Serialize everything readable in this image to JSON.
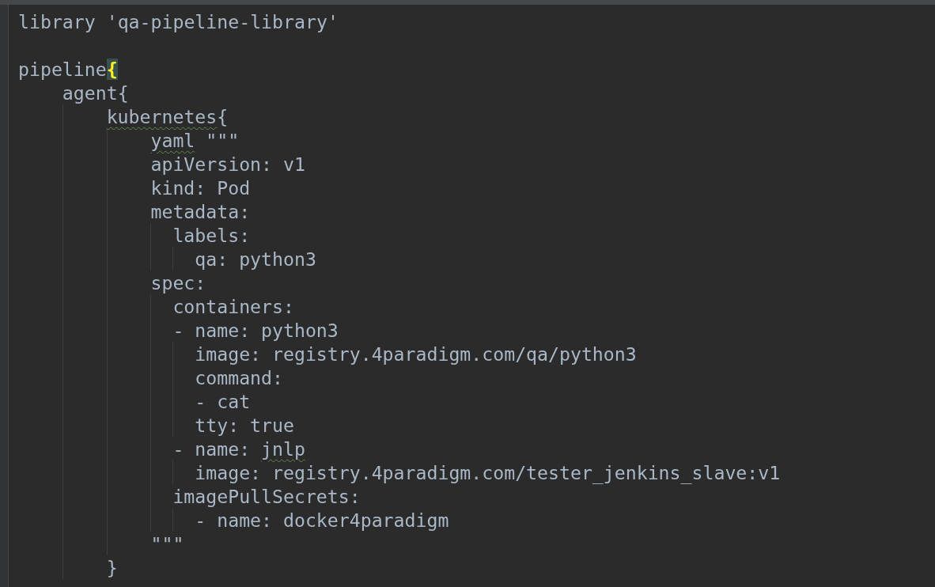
{
  "editor": {
    "lines": [
      {
        "kind": "code",
        "parts": [
          {
            "kind": "plain",
            "text": "library 'qa-pipeline-library'"
          }
        ]
      },
      {
        "kind": "blank"
      },
      {
        "kind": "code",
        "parts": [
          {
            "kind": "plain",
            "text": "pipeline"
          },
          {
            "kind": "brace-match",
            "text": "{"
          }
        ],
        "children": [
          {
            "kind": "code",
            "parts": [
              {
                "kind": "plain",
                "text": "agent{"
              }
            ],
            "children": [
              {
                "kind": "code",
                "parts": [
                  {
                    "kind": "typo",
                    "text": "kubernetes"
                  },
                  {
                    "kind": "plain",
                    "text": "{"
                  }
                ],
                "children": [
                  {
                    "kind": "code",
                    "parts": [
                      {
                        "kind": "typo",
                        "text": "yaml"
                      },
                      {
                        "kind": "plain",
                        "text": " \"\"\""
                      }
                    ]
                  },
                  {
                    "kind": "yaml",
                    "parts": [
                      {
                        "kind": "plain",
                        "text": "apiVersion: v1"
                      }
                    ]
                  },
                  {
                    "kind": "yaml",
                    "parts": [
                      {
                        "kind": "plain",
                        "text": "kind: Pod"
                      }
                    ]
                  },
                  {
                    "kind": "yaml",
                    "parts": [
                      {
                        "kind": "plain",
                        "text": "metadata:"
                      }
                    ],
                    "children": [
                      {
                        "kind": "yaml",
                        "parts": [
                          {
                            "kind": "plain",
                            "text": "labels:"
                          }
                        ],
                        "children": [
                          {
                            "kind": "yaml",
                            "parts": [
                              {
                                "kind": "plain",
                                "text": "qa: python3"
                              }
                            ]
                          }
                        ]
                      }
                    ]
                  },
                  {
                    "kind": "yaml",
                    "parts": [
                      {
                        "kind": "plain",
                        "text": "spec:"
                      }
                    ],
                    "children": [
                      {
                        "kind": "yaml",
                        "parts": [
                          {
                            "kind": "plain",
                            "text": "containers:"
                          }
                        ]
                      },
                      {
                        "kind": "yaml",
                        "parts": [
                          {
                            "kind": "plain",
                            "text": "- name: python3"
                          }
                        ],
                        "children": [
                          {
                            "kind": "yaml",
                            "parts": [
                              {
                                "kind": "plain",
                                "text": "image: registry.4paradigm.com/qa/python3"
                              }
                            ]
                          },
                          {
                            "kind": "yaml",
                            "parts": [
                              {
                                "kind": "plain",
                                "text": "command:"
                              }
                            ]
                          },
                          {
                            "kind": "yaml",
                            "parts": [
                              {
                                "kind": "plain",
                                "text": "- cat"
                              }
                            ]
                          },
                          {
                            "kind": "yaml",
                            "parts": [
                              {
                                "kind": "plain",
                                "text": "tty: true"
                              }
                            ]
                          }
                        ]
                      },
                      {
                        "kind": "yaml",
                        "parts": [
                          {
                            "kind": "plain",
                            "text": "- name: "
                          },
                          {
                            "kind": "typo",
                            "text": "jnlp"
                          }
                        ],
                        "children": [
                          {
                            "kind": "yaml",
                            "parts": [
                              {
                                "kind": "plain",
                                "text": "image: registry.4paradigm.com/tester_jenkins_slave:v1"
                              }
                            ]
                          }
                        ]
                      },
                      {
                        "kind": "yaml",
                        "parts": [
                          {
                            "kind": "plain",
                            "text": "imagePullSecrets:"
                          }
                        ],
                        "children": [
                          {
                            "kind": "yaml",
                            "parts": [
                              {
                                "kind": "plain",
                                "text": "- name: docker4paradigm"
                              }
                            ]
                          }
                        ]
                      }
                    ]
                  },
                  {
                    "kind": "code",
                    "parts": [
                      {
                        "kind": "plain",
                        "text": "\"\"\""
                      }
                    ]
                  }
                ]
              },
              {
                "kind": "code",
                "parts": [
                  {
                    "kind": "plain",
                    "text": "}"
                  }
                ]
              }
            ]
          }
        ]
      }
    ]
  }
}
